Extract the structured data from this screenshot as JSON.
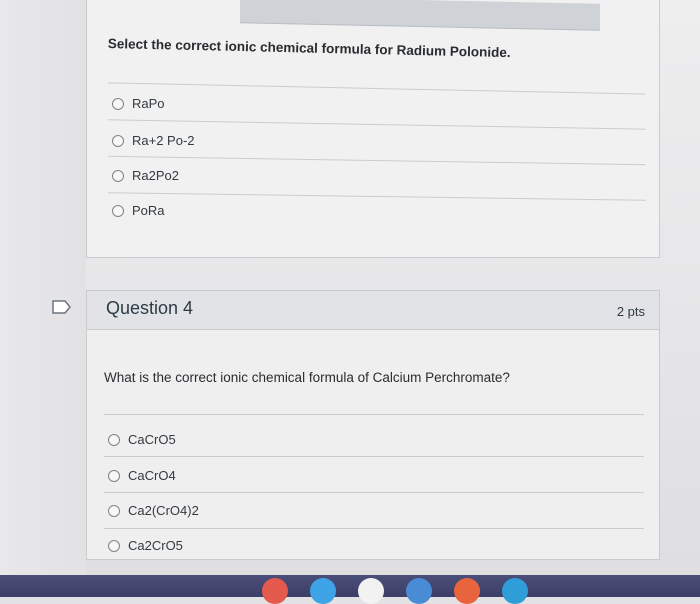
{
  "question3": {
    "text": "Select the correct ionic chemical formula for Radium Polonide.",
    "options": [
      "RaPo",
      "Ra+2 Po-2",
      "Ra2Po2",
      "PoRa"
    ]
  },
  "question4": {
    "title": "Question 4",
    "points": "2 pts",
    "text": "What is the correct ionic chemical formula of Calcium Perchromate?",
    "options": [
      "CaCrO5",
      "CaCrO4",
      "Ca2(CrO4)2",
      "Ca2CrO5"
    ]
  },
  "colors": {
    "header_bg": "#e1e3e6",
    "card_bg": "#efeff0",
    "taskbar": "#3b3f68"
  }
}
